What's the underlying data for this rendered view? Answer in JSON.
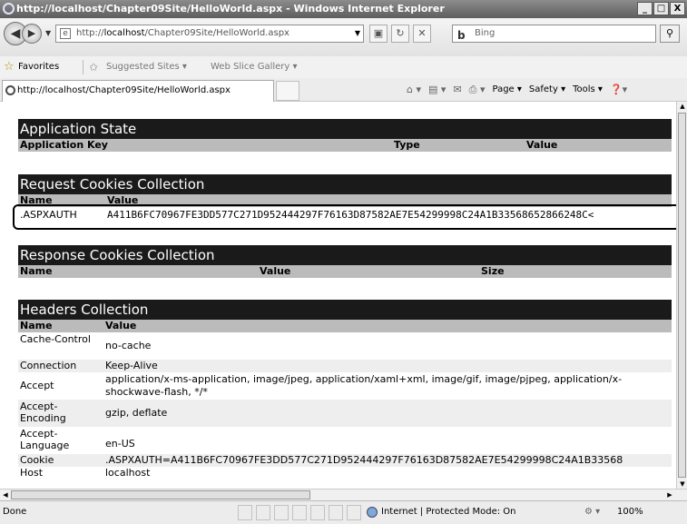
{
  "window": {
    "title": "http://localhost/Chapter09Site/HelloWorld.aspx - Windows Internet Explorer",
    "buttons": [
      "_",
      "□",
      "X"
    ]
  },
  "address_bar": {
    "url_prefix": "http://",
    "url_host": "localhost",
    "url_path": "/Chapter09Site/HelloWorld.aspx",
    "search_placeholder": "Bing"
  },
  "favorites_bar": {
    "favorites_label": "Favorites",
    "suggested_sites": "Suggested Sites ▾",
    "web_slice_gallery": "Web Slice Gallery ▾"
  },
  "tab": {
    "label": "http://localhost/Chapter09Site/HelloWorld.aspx"
  },
  "command_bar": {
    "page": "Page ▾",
    "safety": "Safety ▾",
    "tools": "Tools ▾"
  },
  "content": {
    "application_state": {
      "title": "Application State",
      "headers": [
        "Application Key",
        "Type",
        "Value"
      ]
    },
    "request_cookies": {
      "title": "Request Cookies Collection",
      "headers": [
        "Name",
        "Value"
      ],
      "rows": [
        {
          "name": ".ASPXAUTH",
          "value": "A411B6FC70967FE3DD577C271D952444297F76163D87582AE7E54299998C24A1B33568652866248C<"
        }
      ]
    },
    "response_cookies": {
      "title": "Response Cookies Collection",
      "headers": [
        "Name",
        "Value",
        "Size"
      ]
    },
    "headers_collection": {
      "title": "Headers Collection",
      "headers": [
        "Name",
        "Value"
      ],
      "rows": [
        {
          "name": "Cache-Control",
          "value": "no-cache"
        },
        {
          "name": "Connection",
          "value": "Keep-Alive"
        },
        {
          "name": "Accept",
          "value": "application/x-ms-application, image/jpeg, application/xaml+xml, image/gif, image/pjpeg, application/x-shockwave-flash, */*"
        },
        {
          "name": "Accept-Encoding",
          "value": "gzip, deflate"
        },
        {
          "name": "Accept-Language",
          "value": "en-US"
        },
        {
          "name": "Cookie",
          "value": ".ASPXAUTH=A411B6FC70967FE3DD577C271D952444297F76163D87582AE7E54299998C24A1B33568"
        },
        {
          "name": "Host",
          "value": "localhost"
        }
      ]
    }
  },
  "status_bar": {
    "left_text": "Done",
    "zone_text": "Internet | Protected Mode: On",
    "zoom_text": "100%"
  }
}
